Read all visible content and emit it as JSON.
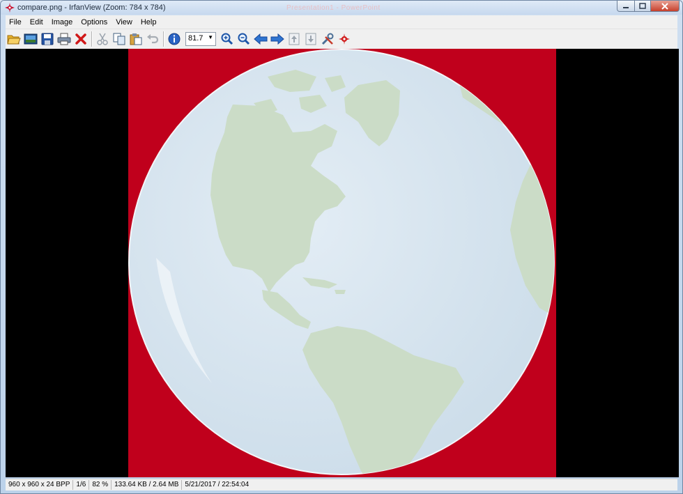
{
  "window": {
    "title": "compare.png - IrfanView (Zoom: 784 x 784)",
    "ghost_title": "Presentation1  -  PowerPoint"
  },
  "menu": [
    "File",
    "Edit",
    "Image",
    "Options",
    "View",
    "Help"
  ],
  "toolbar": {
    "buttons": [
      "open-icon",
      "thumbnails-icon",
      "save-icon",
      "print-icon",
      "delete-icon",
      "cut-icon",
      "copy-icon",
      "paste-icon",
      "undo-icon",
      "info-icon",
      "zoom-in-icon",
      "zoom-out-icon",
      "previous-icon",
      "next-icon",
      "first-page-icon",
      "last-page-icon",
      "properties-icon",
      "exit-icon"
    ],
    "zoom_value": "81.7"
  },
  "image": {
    "background_color": "#c0001c",
    "globe_color": "#dde9f2",
    "land_color": "#ccdcc8"
  },
  "status": {
    "dimensions": "960 x 960 x 24 BPP",
    "page": "1/6",
    "zoom": "82 %",
    "size": "133.64 KB / 2.64 MB",
    "datetime": "5/21/2017 / 22:54:04"
  }
}
